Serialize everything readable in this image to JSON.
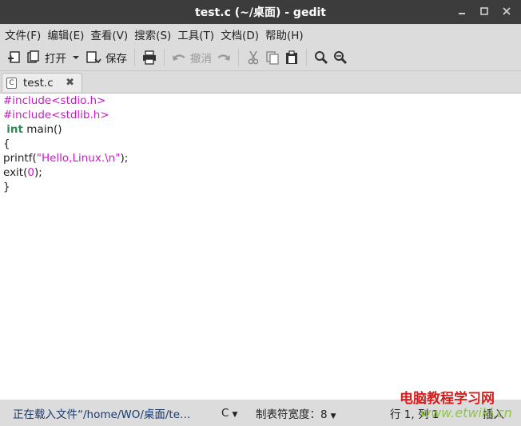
{
  "window": {
    "title": "test.c (~/桌面) - gedit"
  },
  "menu": [
    "文件(F)",
    "编辑(E)",
    "查看(V)",
    "搜索(S)",
    "工具(T)",
    "文档(D)",
    "帮助(H)"
  ],
  "toolbar": {
    "open_label": "打开",
    "save_label": "保存",
    "undo_label": "撤消"
  },
  "tab": {
    "filename": "test.c",
    "type_badge": "C"
  },
  "code": {
    "line1": "#include<stdio.h>",
    "line2": "#include<stdlib.h>",
    "line3_kw": "int",
    "line3_rest": " main()",
    "line4": "{",
    "line5_a": "printf(",
    "line5_str": "\"Hello,Linux.\\n\"",
    "line5_b": ");",
    "line6_a": "exit(",
    "line6_num": "0",
    "line6_b": ");",
    "line7": "}"
  },
  "status": {
    "message": "正在载入文件“/home/WO/桌面/te…",
    "language": "C",
    "tab_width": "制表符宽度：8",
    "position": "行 1, 列 1",
    "mode": "插入"
  },
  "watermark": {
    "line1": "电脑教程学习网",
    "line2": "www.etwiki.cn"
  }
}
